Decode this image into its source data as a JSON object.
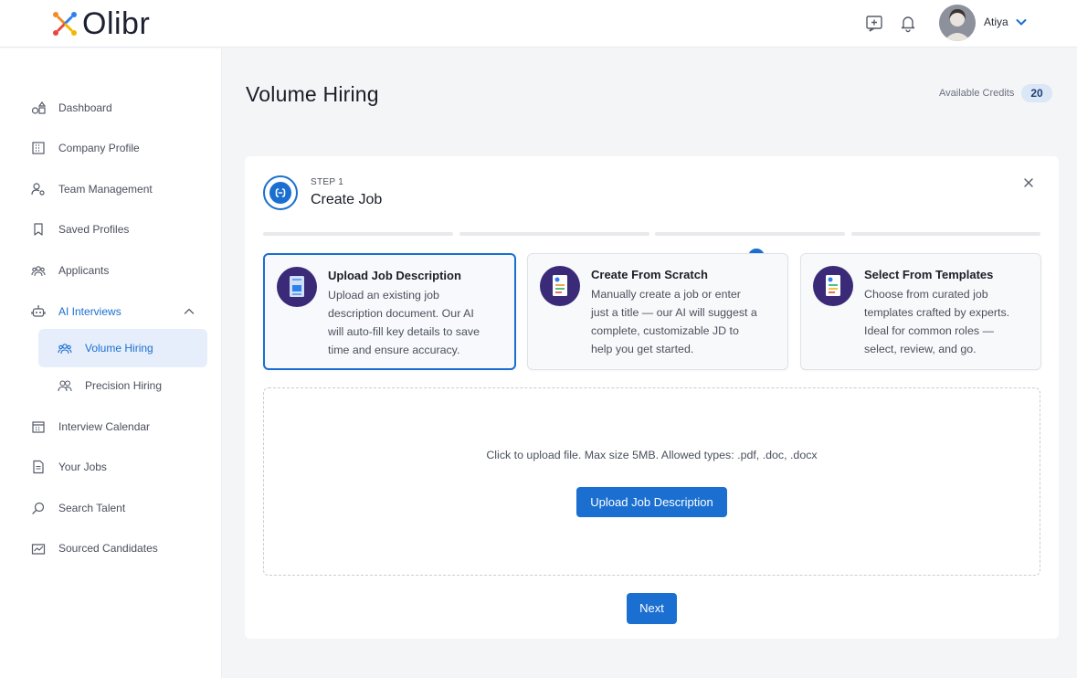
{
  "header": {
    "logo_text": "Olibr",
    "user_name": "Atiya",
    "icons": [
      "add-note-icon",
      "bell-icon",
      "avatar",
      "chevron-down-icon"
    ]
  },
  "sidebar": {
    "items": [
      {
        "label": "Dashboard",
        "icon": "dashboard-icon"
      },
      {
        "label": "Company Profile",
        "icon": "building-icon"
      },
      {
        "label": "Team Management",
        "icon": "user-gear-icon"
      },
      {
        "label": "Saved Profiles",
        "icon": "bookmark-icon"
      },
      {
        "label": "Applicants",
        "icon": "users-group-icon"
      },
      {
        "label": "AI Interviews",
        "icon": "robot-icon",
        "expanded": true,
        "children": [
          {
            "label": "Volume Hiring",
            "icon": "users-group-icon",
            "active": true
          },
          {
            "label": "Precision Hiring",
            "icon": "two-users-icon"
          }
        ]
      },
      {
        "label": "Interview Calendar",
        "icon": "calendar-icon"
      },
      {
        "label": "Your Jobs",
        "icon": "document-icon"
      },
      {
        "label": "Search Talent",
        "icon": "search-icon"
      },
      {
        "label": "Sourced Candidates",
        "icon": "chart-icon"
      }
    ]
  },
  "main": {
    "title": "Volume Hiring",
    "credits_label": "Available Credits",
    "credits_value": "20",
    "step": {
      "label": "STEP 1",
      "title": "Create Job"
    },
    "options": [
      {
        "title": "Upload Job Description",
        "desc": [
          "Upload an existing job",
          "description document. Our AI",
          "will auto-fill key details to save",
          "time and ensure accuracy."
        ],
        "selected": true
      },
      {
        "title": "Create From Scratch",
        "desc": [
          "Manually create a job or enter",
          "just a title — our AI will suggest a",
          "complete, customizable JD to",
          "help you get started."
        ],
        "selected": false
      },
      {
        "title": "Select From Templates",
        "desc": [
          "Choose from curated job",
          "templates crafted by experts.",
          "Ideal for common roles —",
          "select, review, and go."
        ],
        "selected": false
      }
    ],
    "upload_hint": "Click to upload file. Max size 5MB. Allowed types: .pdf, .doc, .docx",
    "upload_button": "Upload Job Description",
    "next_button": "Next"
  },
  "colors": {
    "accent": "#1a6fd1",
    "icon_circle": "#3a2a78",
    "credits_badge_bg": "#dbe6f6"
  }
}
